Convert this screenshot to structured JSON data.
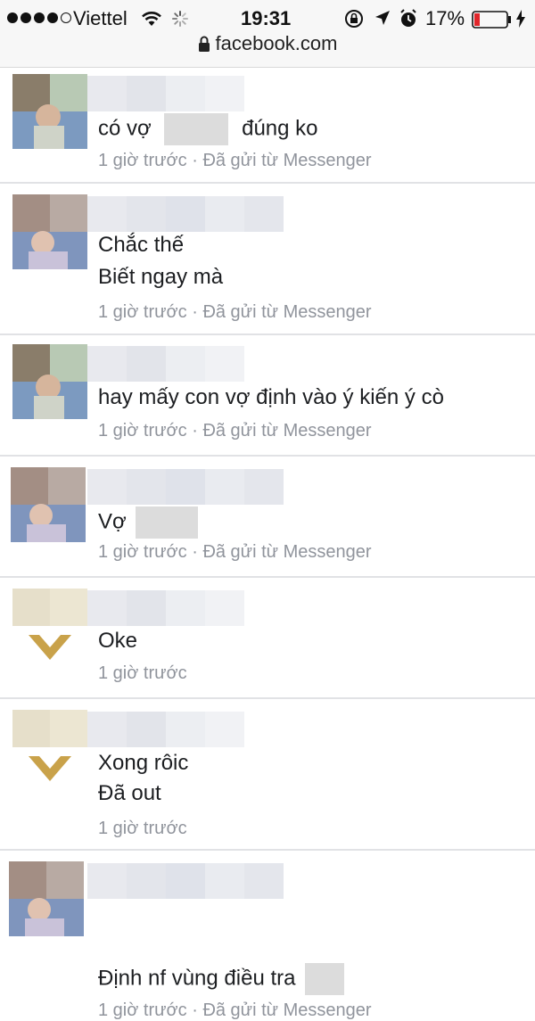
{
  "status_bar": {
    "carrier": "Viettel",
    "time": "19:31",
    "battery_percent": "17%",
    "battery_level": 0.17,
    "signal_bars_filled": 4,
    "signal_bars_total": 5,
    "icons": [
      "signal-dots-icon",
      "wifi-icon",
      "loading-spinner-icon",
      "rotation-lock-icon",
      "location-arrow-icon",
      "alarm-clock-icon",
      "battery-icon",
      "charging-bolt-icon"
    ]
  },
  "browser": {
    "url": "facebook.com",
    "secure_icon": "padlock-icon"
  },
  "comments": [
    {
      "lines": [
        "có vợ",
        "đúng ko"
      ],
      "time": "1 giờ trước",
      "separator": "·",
      "source": "Đã gửi từ Messenger"
    },
    {
      "lines": [
        "Chắc thế",
        "Biết ngay mà"
      ],
      "time": "1 giờ trước",
      "separator": "·",
      "source": "Đã gửi từ Messenger"
    },
    {
      "lines": [
        "hay mấy con vợ định vào ý kiến ý cò"
      ],
      "time": "1 giờ trước",
      "separator": "·",
      "source": "Đã gửi từ Messenger"
    },
    {
      "lines": [
        "Vợ"
      ],
      "time": "1 giờ trước",
      "separator": "·",
      "source": "Đã gửi từ Messenger"
    },
    {
      "lines": [
        "Oke"
      ],
      "time": "1 giờ trước"
    },
    {
      "lines": [
        "Xong rôic",
        "Đã out"
      ],
      "time": "1 giờ trước"
    },
    {
      "lines": [
        "Định nf vùng điều tra"
      ],
      "time": "1 giờ trước",
      "separator": "·",
      "source": "Đã gửi từ Messenger"
    }
  ],
  "colors": {
    "status_bar_bg": "#f7f7f7",
    "text": "#1c1e21",
    "meta_text": "#90949c",
    "divider": "#e1e2e5",
    "battery_low": "#e0262b"
  }
}
